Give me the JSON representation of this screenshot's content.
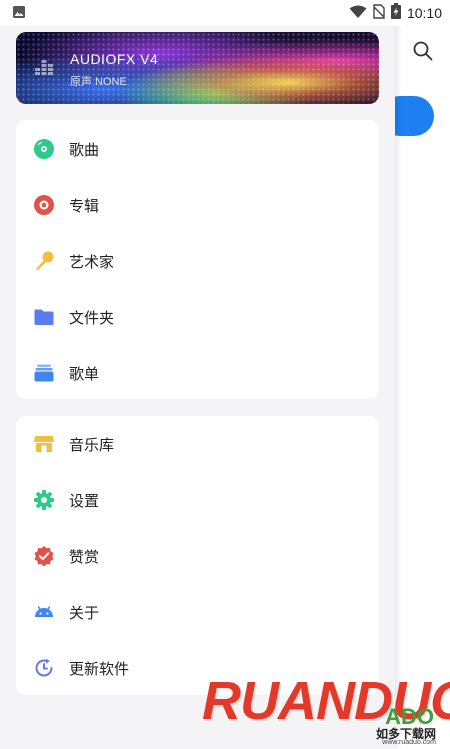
{
  "status_bar": {
    "time": "10:10",
    "icons": [
      "image-icon",
      "wifi-icon",
      "no-sim-icon",
      "battery-charging-icon"
    ]
  },
  "background_page": {
    "search_icon": "search-icon",
    "accent_color": "#1e7ff0"
  },
  "drawer": {
    "header": {
      "title": "AUDIOFX V4",
      "subtitle": "原声 NONE",
      "logo_icon": "equalizer-icon"
    },
    "primary_items": [
      {
        "label": "歌曲",
        "icon": "song-disc-icon",
        "color": "#2ec98b"
      },
      {
        "label": "专辑",
        "icon": "album-icon",
        "color": "#e0524a"
      },
      {
        "label": "艺术家",
        "icon": "microphone-icon",
        "color": "#f2be3e"
      },
      {
        "label": "文件夹",
        "icon": "folder-icon",
        "color": "#5b7cf0"
      },
      {
        "label": "歌单",
        "icon": "playlist-icon",
        "color": "#3f86f0"
      }
    ],
    "secondary_items": [
      {
        "label": "音乐库",
        "icon": "store-icon",
        "color": "#f2be3e"
      },
      {
        "label": "设置",
        "icon": "gear-icon",
        "color": "#2ec98b"
      },
      {
        "label": "赞赏",
        "icon": "check-badge-icon",
        "color": "#e0524a"
      },
      {
        "label": "关于",
        "icon": "android-icon",
        "color": "#3f86f0"
      },
      {
        "label": "更新软件",
        "icon": "update-clock-icon",
        "color": "#5b7cf0"
      }
    ]
  },
  "watermark": {
    "brand": "RUANDUO",
    "sub": "ADO",
    "cn": "如多下载网",
    "url": "www.ruaduo.com"
  }
}
